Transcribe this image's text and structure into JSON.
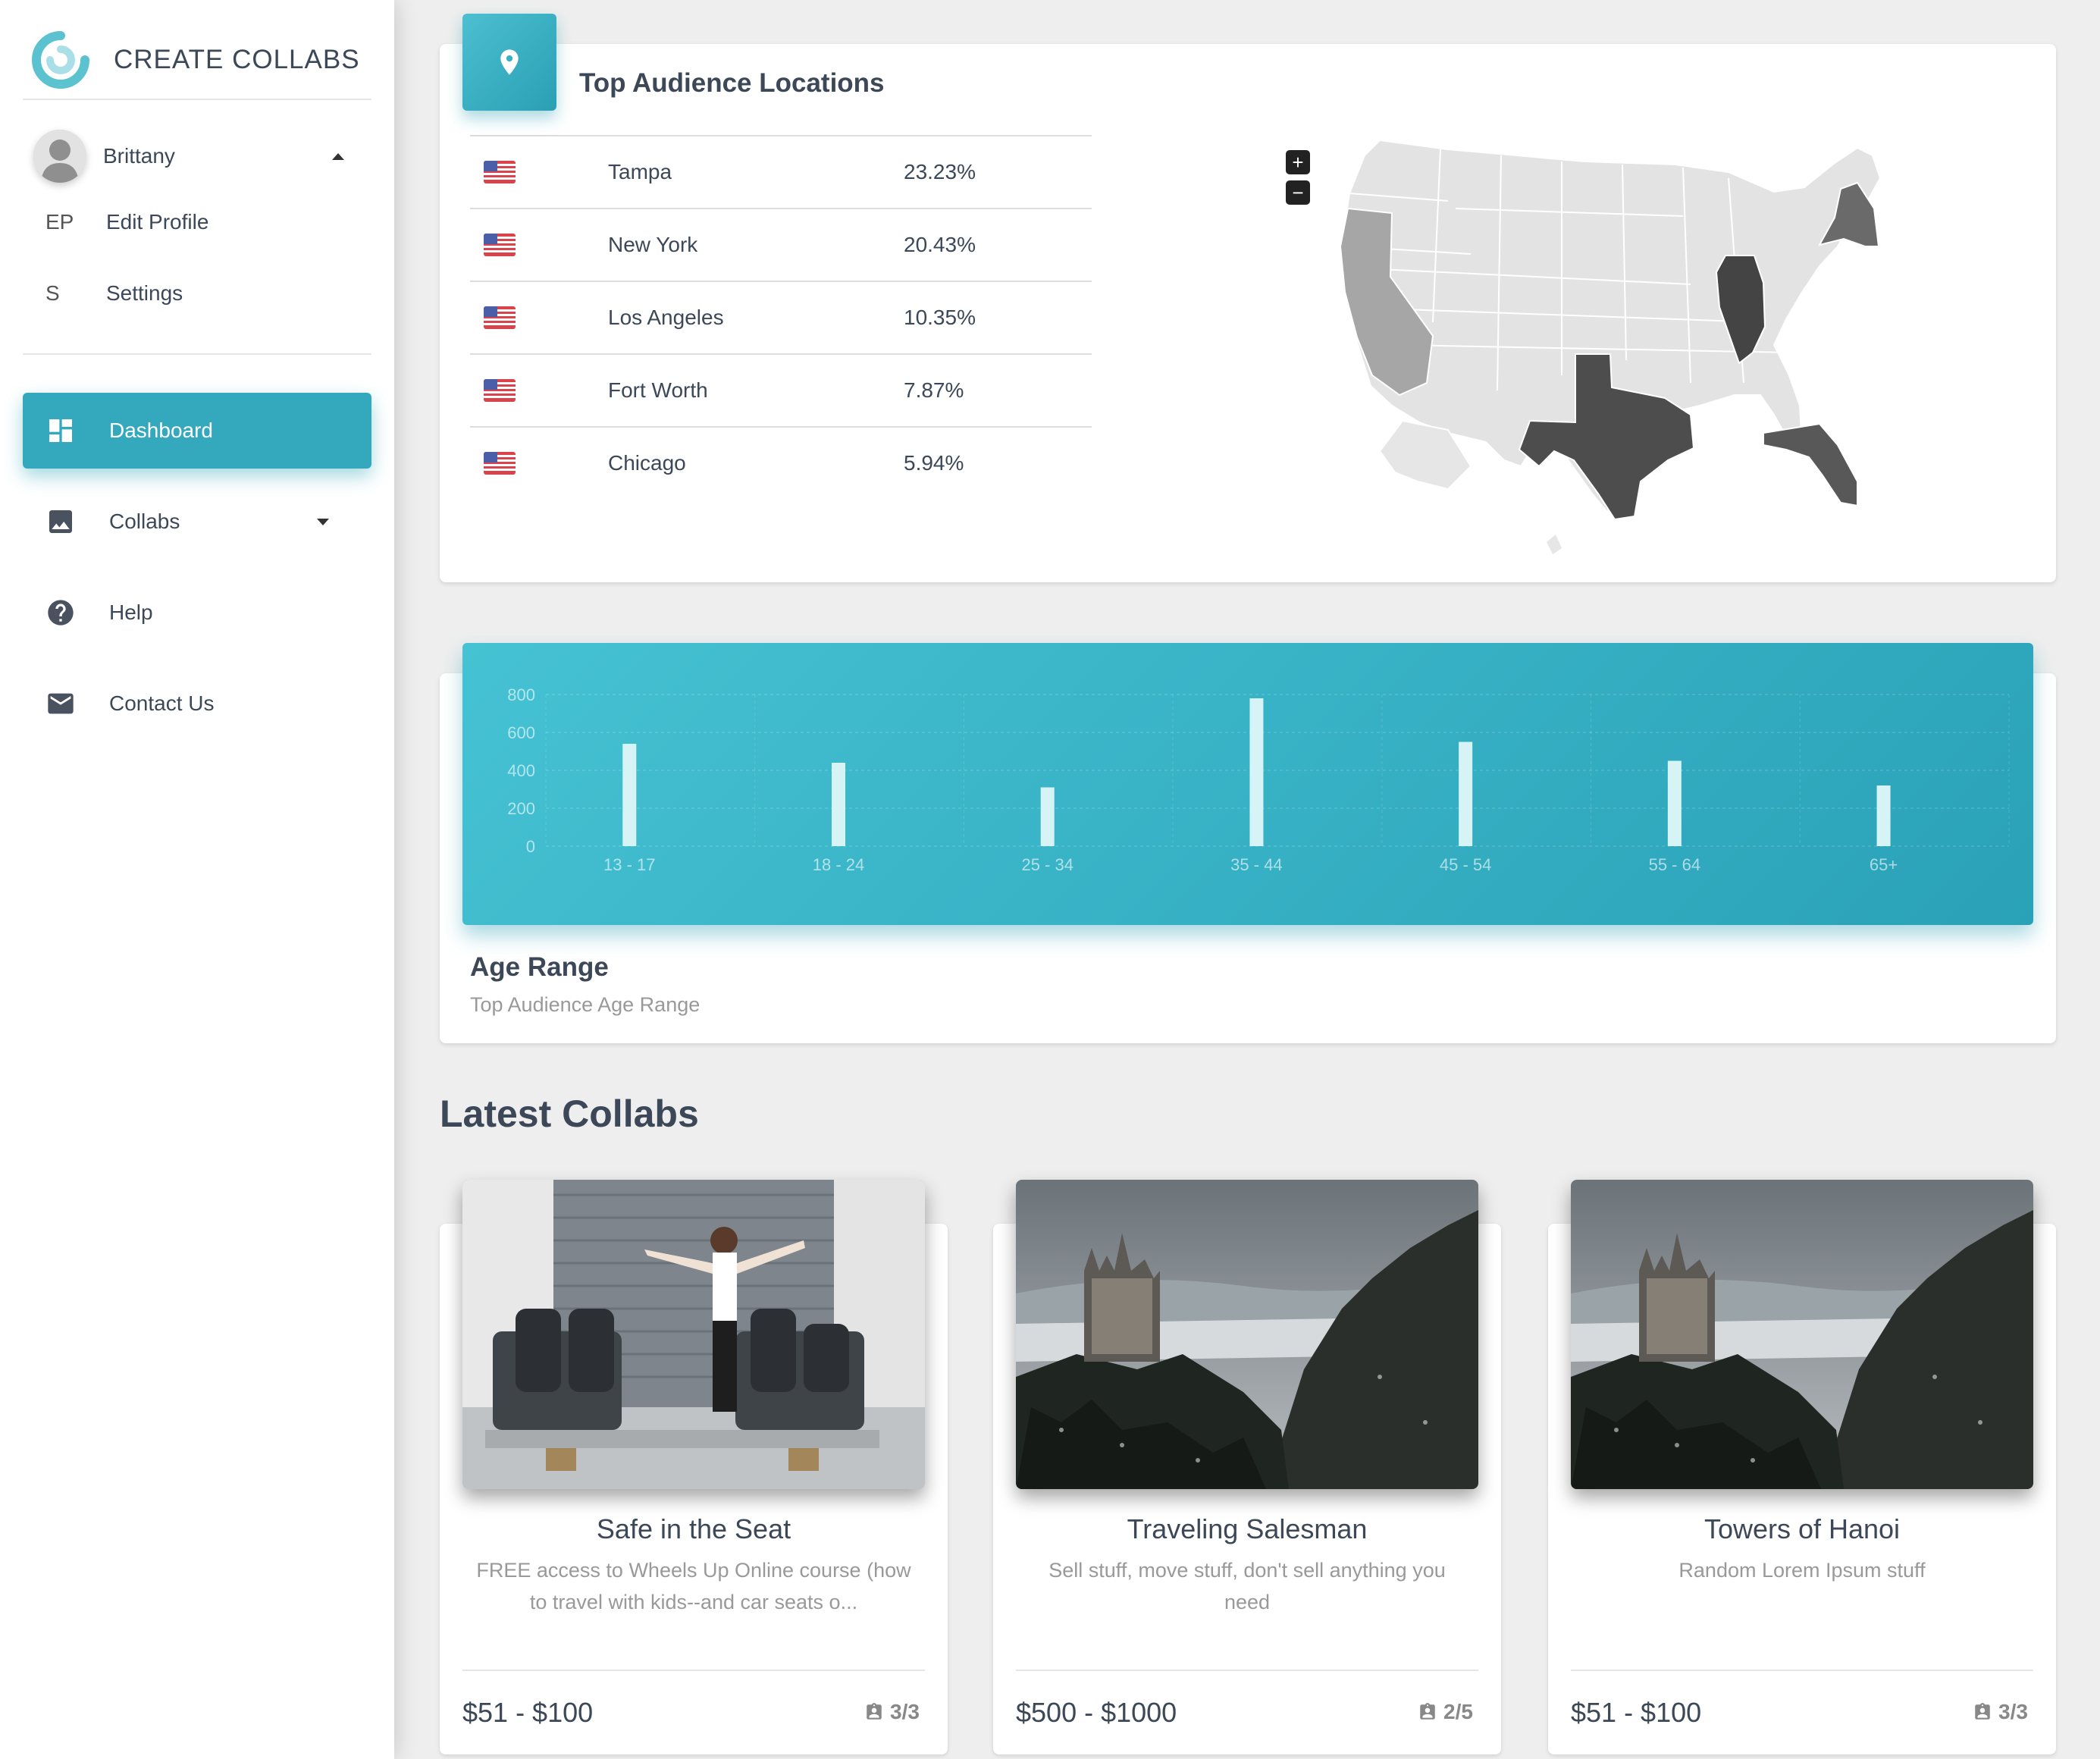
{
  "brand": {
    "name": "CREATE COLLABS"
  },
  "user": {
    "name": "Brittany",
    "menu": [
      {
        "abbr": "EP",
        "label": "Edit Profile"
      },
      {
        "abbr": "S",
        "label": "Settings"
      }
    ]
  },
  "nav": [
    {
      "label": "Dashboard",
      "icon": "dashboard-icon",
      "active": true
    },
    {
      "label": "Collabs",
      "icon": "image-icon",
      "active": false
    },
    {
      "label": "Help",
      "icon": "help-icon",
      "active": false
    },
    {
      "label": "Contact Us",
      "icon": "mail-icon",
      "active": false
    }
  ],
  "locations": {
    "title": "Top Audience Locations",
    "zoom_in": "+",
    "zoom_out": "−",
    "rows": [
      {
        "city": "Tampa",
        "percent": "23.23%"
      },
      {
        "city": "New York",
        "percent": "20.43%"
      },
      {
        "city": "Los Angeles",
        "percent": "10.35%"
      },
      {
        "city": "Fort Worth",
        "percent": "7.87%"
      },
      {
        "city": "Chicago",
        "percent": "5.94%"
      }
    ]
  },
  "age": {
    "title": "Age Range",
    "subtitle": "Top Audience Age Range"
  },
  "chart_data": {
    "type": "bar",
    "categories": [
      "13 - 17",
      "18 - 24",
      "25 - 34",
      "35 - 44",
      "45 - 54",
      "55 - 64",
      "65+"
    ],
    "values": [
      540,
      440,
      310,
      780,
      550,
      450,
      320
    ],
    "ylim": [
      0,
      800
    ],
    "yticks": [
      "800",
      "600",
      "400",
      "200",
      "0"
    ],
    "grid": true,
    "colors": {
      "background": "#34b0c3",
      "bar": "#d6f3f6"
    }
  },
  "collabs": {
    "section_title": "Latest Collabs",
    "items": [
      {
        "title": "Safe in the Seat",
        "description": "FREE access to Wheels Up Online course (how to travel with kids--and car seats o...",
        "price": "$51 - $100",
        "slots": "3/3"
      },
      {
        "title": "Traveling Salesman",
        "description": "Sell stuff, move stuff, don't sell anything you need",
        "price": "$500 - $1000",
        "slots": "2/5"
      },
      {
        "title": "Towers of Hanoi",
        "description": "Random Lorem Ipsum stuff",
        "price": "$51 - $100",
        "slots": "3/3"
      }
    ]
  },
  "colors": {
    "accent": "#34a9bd",
    "text": "#3c4858",
    "muted": "#999999"
  }
}
